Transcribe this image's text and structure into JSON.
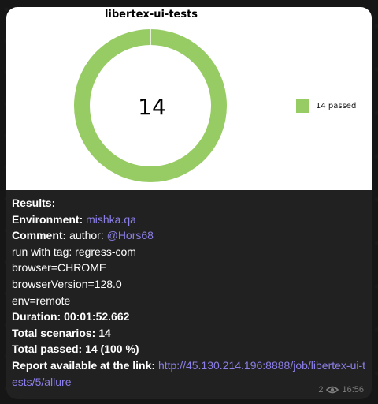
{
  "chart_data": {
    "type": "pie",
    "title": "libertex-ui-tests",
    "center_label": "14",
    "categories": [
      "passed"
    ],
    "values": [
      14
    ],
    "legend": [
      "14 passed"
    ],
    "colors": [
      "#97cc64"
    ],
    "legend_position": "right"
  },
  "message": {
    "results_label": "Results:",
    "environment_label": "Environment:",
    "environment_value": "mishka.qa",
    "comment_label": "Comment:",
    "comment_author_text": "author:",
    "comment_author_handle": "@Hors68",
    "tag_line": "run with tag: regress-com",
    "browser_line": "browser=CHROME",
    "browser_version_line": "browserVersion=128.0",
    "env_line": "env=remote",
    "duration_label": "Duration:",
    "duration_value": "00:01:52.662",
    "scenarios_label": "Total scenarios:",
    "scenarios_value": "14",
    "passed_label": "Total passed:",
    "passed_value": "14 (100 %)",
    "report_label": "Report available at the link:",
    "report_link": "http://45.130.214.196:8888/job/libertex-ui-tests/5/allure"
  },
  "meta": {
    "views": "2",
    "time": "16:56"
  }
}
